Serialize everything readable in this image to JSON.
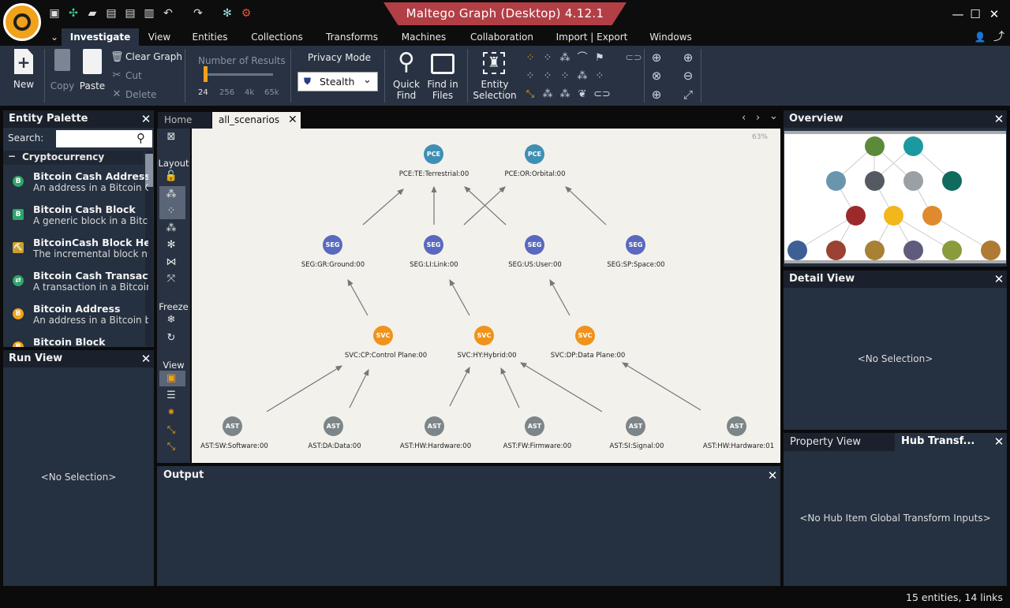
{
  "app": {
    "title": "Maltego Graph (Desktop) 4.12.1"
  },
  "menu": {
    "tabs": [
      "Investigate",
      "View",
      "Entities",
      "Collections",
      "Transforms",
      "Machines",
      "Collaboration",
      "Import | Export",
      "Windows"
    ],
    "active": "Investigate"
  },
  "ribbon": {
    "new_label": "New",
    "copy_label": "Copy",
    "paste_label": "Paste",
    "clear_graph_label": "Clear Graph",
    "cut_label": "Cut",
    "delete_label": "Delete",
    "number_of_results_label": "Number of Results",
    "results_ticks": [
      "24",
      "256",
      "4k",
      "65k"
    ],
    "privacy_mode_label": "Privacy Mode",
    "privacy_mode_value": "Stealth",
    "quick_find_label": "Quick\nFind",
    "quick_find_l1": "Quick",
    "quick_find_l2": "Find",
    "find_files_l1": "Find in",
    "find_files_l2": "Files",
    "entity_selection_l1": "Entity",
    "entity_selection_l2": "Selection"
  },
  "entity_palette": {
    "title": "Entity Palette",
    "search_label": "Search:",
    "search_value": "",
    "category": "Cryptocurrency",
    "items": [
      {
        "name": "Bitcoin Cash Address",
        "desc": "An address in a Bitcoin Cash",
        "color": "#2fa56b",
        "icon": "B"
      },
      {
        "name": "Bitcoin Cash Block",
        "desc": "A generic block in a Bitcoin Cash",
        "color": "#2fa56b",
        "icon": "B"
      },
      {
        "name": "BitcoinCash Block Height",
        "desc": "The incremental block number",
        "color": "#caa128",
        "icon": "⛏"
      },
      {
        "name": "Bitcoin Cash Transaction",
        "desc": "A transaction in a Bitcoin Cash",
        "color": "#2fa56b",
        "icon": "⇄"
      },
      {
        "name": "Bitcoin Address",
        "desc": "An address in a Bitcoin block",
        "color": "#f2a31a",
        "icon": "B"
      },
      {
        "name": "Bitcoin Block",
        "desc": "",
        "color": "#f2a31a",
        "icon": "B"
      }
    ]
  },
  "run_view": {
    "title": "Run View",
    "empty": "<No Selection>"
  },
  "doc_tabs": {
    "home": "Home",
    "active": "all_scenarios"
  },
  "graph_toolbar": {
    "layout_label": "Layout",
    "freeze_label": "Freeze",
    "view_label": "View"
  },
  "graph": {
    "zoom": "63%",
    "nodes": [
      {
        "type": "PCE",
        "label": "PCE:TE:Terrestrial:00",
        "color": "#3f8fb5"
      },
      {
        "type": "PCE",
        "label": "PCE:OR:Orbital:00",
        "color": "#3f8fb5"
      },
      {
        "type": "SEG",
        "label": "SEG:GR:Ground:00",
        "color": "#5a69bf"
      },
      {
        "type": "SEG",
        "label": "SEG:LI:Link:00",
        "color": "#5a69bf"
      },
      {
        "type": "SEG",
        "label": "SEG:US:User:00",
        "color": "#5a69bf"
      },
      {
        "type": "SEG",
        "label": "SEG:SP:Space:00",
        "color": "#5a69bf"
      },
      {
        "type": "SVC",
        "label": "SVC:CP:Control Plane:00",
        "color": "#f0931c"
      },
      {
        "type": "SVC",
        "label": "SVC:HY:Hybrid:00",
        "color": "#f0931c"
      },
      {
        "type": "SVC",
        "label": "SVC:DP:Data Plane:00",
        "color": "#f0931c"
      },
      {
        "type": "AST",
        "label": "AST:SW:Software:00",
        "color": "#7c8587"
      },
      {
        "type": "AST",
        "label": "AST:DA:Data:00",
        "color": "#7c8587"
      },
      {
        "type": "AST",
        "label": "AST:HW:Hardware:00",
        "color": "#7c8587"
      },
      {
        "type": "AST",
        "label": "AST:FW:Firmware:00",
        "color": "#7c8587"
      },
      {
        "type": "AST",
        "label": "AST:SI:Signal:00",
        "color": "#7c8587"
      },
      {
        "type": "AST",
        "label": "AST:HW:Hardware:01",
        "color": "#7c8587"
      }
    ]
  },
  "output": {
    "title": "Output"
  },
  "overview": {
    "title": "Overview",
    "node_colors": [
      "#5b8a3a",
      "#1a9aa0",
      "#6a96ad",
      "#555a62",
      "#9aa0a5",
      "#0f6b5e",
      "#9c2a2a",
      "#f2b71b",
      "#e08a2e",
      "#3e5f95",
      "#9b4232",
      "#a98134",
      "#5e5b7d",
      "#8a9b3b",
      "#b07a35"
    ]
  },
  "detail_view": {
    "title": "Detail View",
    "empty": "<No Selection>"
  },
  "property_tabs": {
    "property_view": "Property View",
    "hub": "Hub Transf...",
    "empty": "<No Hub Item Global Transform Inputs>"
  },
  "status": {
    "summary": "15 entities, 14 links"
  }
}
